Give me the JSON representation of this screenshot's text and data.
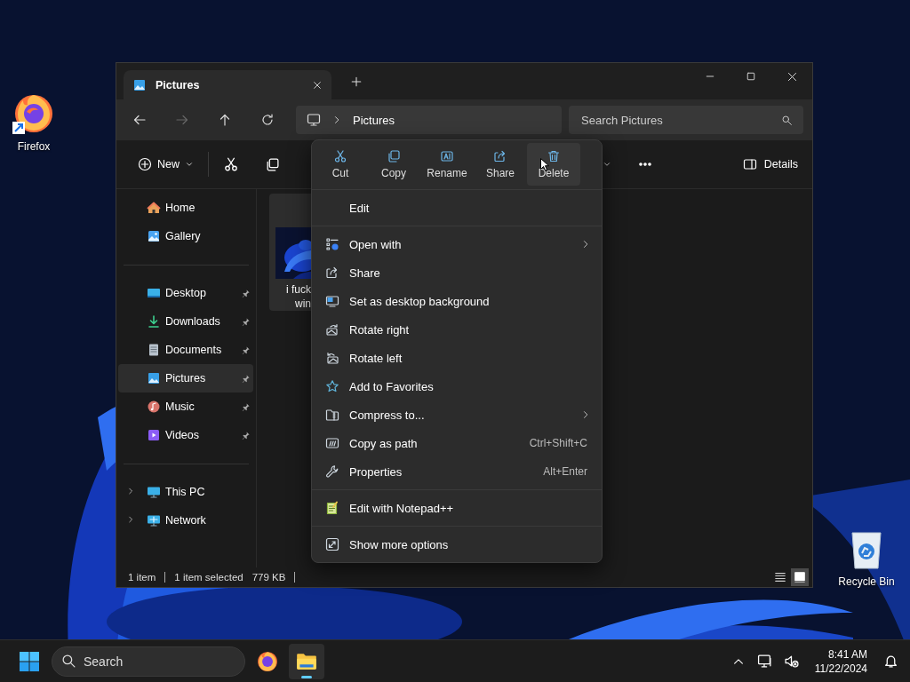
{
  "desktop_icons": [
    {
      "kind": "firefox",
      "label": "Firefox"
    },
    {
      "kind": "recycle-bin",
      "label": "Recycle Bin"
    }
  ],
  "window": {
    "tabs": [
      {
        "title": "Pictures",
        "selected": true
      }
    ],
    "address": {
      "crumbs": [
        "Pictures"
      ]
    },
    "search": {
      "placeholder": "Search Pictures"
    },
    "toolbar": {
      "new_label": "New",
      "details_label": "Details"
    },
    "sidebar": {
      "groups": [
        [
          {
            "kind": "home",
            "label": "Home",
            "selected": false,
            "pinned": false
          },
          {
            "kind": "gallery",
            "label": "Gallery",
            "selected": false,
            "pinned": false
          }
        ],
        [
          {
            "kind": "desktop",
            "label": "Desktop",
            "selected": false,
            "pinned": true
          },
          {
            "kind": "downloads",
            "label": "Downloads",
            "selected": false,
            "pinned": true
          },
          {
            "kind": "documents",
            "label": "Documents",
            "selected": false,
            "pinned": true
          },
          {
            "kind": "pictures",
            "label": "Pictures",
            "selected": true,
            "pinned": true
          },
          {
            "kind": "music",
            "label": "Music",
            "selected": false,
            "pinned": true
          },
          {
            "kind": "videos",
            "label": "Videos",
            "selected": false,
            "pinned": true
          }
        ],
        [
          {
            "kind": "pc",
            "label": "This PC",
            "selected": false,
            "expanded": false
          },
          {
            "kind": "network",
            "label": "Network",
            "selected": false,
            "expanded": false
          }
        ]
      ]
    },
    "files": [
      {
        "name_lines": [
          "i fuck",
          "win"
        ],
        "selected": true
      }
    ],
    "status_bar": {
      "items": [
        "1 item",
        "1 item selected",
        "779 KB"
      ],
      "views": [
        {
          "kind": "details",
          "selected": false
        },
        {
          "kind": "tiles",
          "selected": true
        }
      ]
    }
  },
  "context_menu": {
    "quick_actions": [
      {
        "kind": "cut",
        "label": "Cut",
        "hovered": false
      },
      {
        "kind": "copy",
        "label": "Copy",
        "hovered": false
      },
      {
        "kind": "rename",
        "label": "Rename",
        "hovered": false
      },
      {
        "kind": "share",
        "label": "Share",
        "hovered": false
      },
      {
        "kind": "delete",
        "label": "Delete",
        "hovered": true
      }
    ],
    "sections": [
      [
        {
          "kind": "edit",
          "label": "Edit",
          "submenu": false
        }
      ],
      [
        {
          "kind": "open-with",
          "label": "Open with",
          "submenu": true
        },
        {
          "kind": "share",
          "label": "Share",
          "submenu": false
        },
        {
          "kind": "wallpaper",
          "label": "Set as desktop background",
          "submenu": false
        },
        {
          "kind": "rotate-right",
          "label": "Rotate right",
          "submenu": false
        },
        {
          "kind": "rotate-left",
          "label": "Rotate left",
          "submenu": false
        },
        {
          "kind": "star",
          "label": "Add to Favorites",
          "submenu": false
        },
        {
          "kind": "zip",
          "label": "Compress to...",
          "submenu": true
        },
        {
          "kind": "copy-path",
          "label": "Copy as path",
          "submenu": false,
          "shortcut": "Ctrl+Shift+C"
        },
        {
          "kind": "wrench",
          "label": "Properties",
          "submenu": false,
          "shortcut": "Alt+Enter"
        }
      ],
      [
        {
          "kind": "notepad",
          "label": "Edit with Notepad++",
          "submenu": false
        }
      ],
      [
        {
          "kind": "more",
          "label": "Show more options",
          "submenu": false
        }
      ]
    ]
  },
  "taskbar": {
    "search_placeholder": "Search",
    "apps": [
      {
        "kind": "firefox",
        "selected": false
      },
      {
        "kind": "explorer",
        "selected": true
      }
    ],
    "time": "8:41 AM",
    "date": "11/22/2024"
  }
}
